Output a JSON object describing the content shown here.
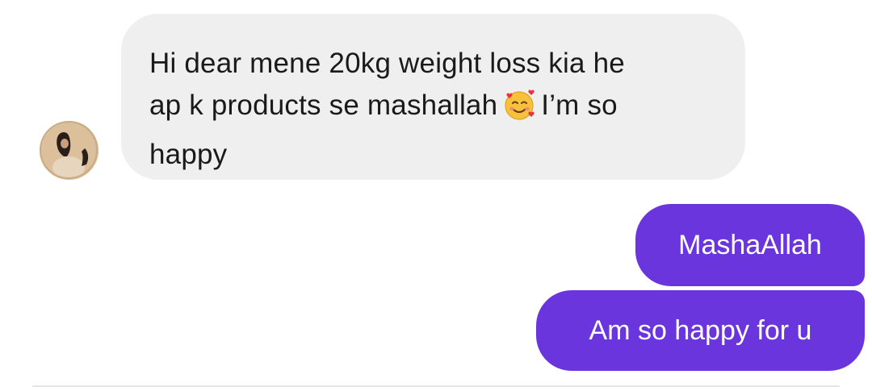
{
  "messages": {
    "incoming": {
      "text_line1": "Hi dear mene 20kg weight loss kia he",
      "text_line2_before": "ap k products se mashallah",
      "emoji": "smiling-face-with-hearts",
      "text_line2_after": "I’m so",
      "text_line3": "happy"
    },
    "outgoing": [
      {
        "text": "MashaAllah"
      },
      {
        "text": "Am so happy for u"
      }
    ]
  },
  "colors": {
    "incoming_bubble": "#efefef",
    "outgoing_bubble": "#6a35dc",
    "incoming_text": "#1a1a1a",
    "outgoing_text": "#ffffff"
  }
}
